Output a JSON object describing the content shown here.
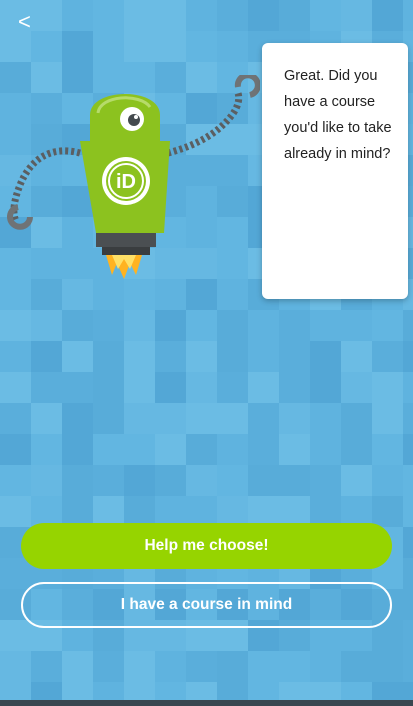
{
  "nav": {
    "back_label": "<"
  },
  "mascot": {
    "badge_text": "iD",
    "icon": "robot-mascot-icon"
  },
  "speech": {
    "text": "Great. Did you have a course you'd like to take already in mind?"
  },
  "actions": {
    "primary_label": "Help me choose!",
    "secondary_label": "I have a course in mind"
  },
  "colors": {
    "background": "#5fb3df",
    "accent_green": "#96d400",
    "robot_green": "#8cc21f",
    "card": "#ffffff"
  }
}
